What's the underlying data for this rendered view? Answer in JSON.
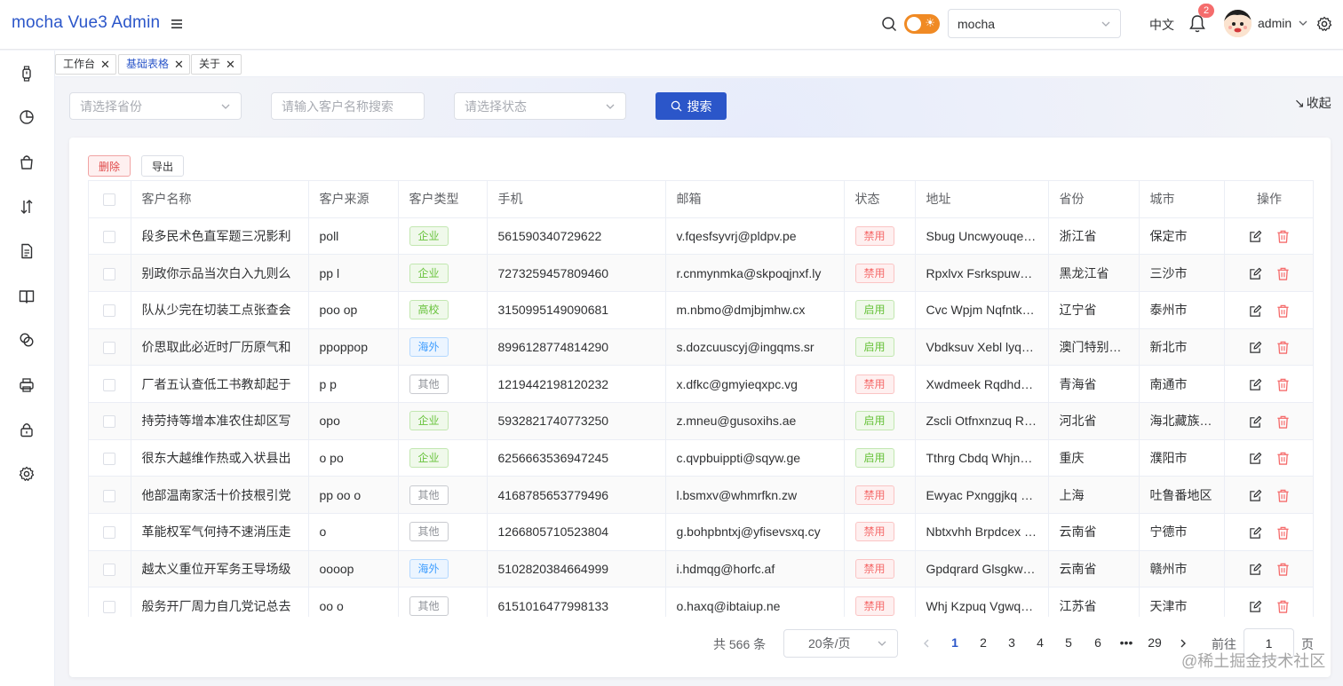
{
  "header": {
    "logo": "mocha Vue3 Admin",
    "select_value": "mocha",
    "lang": "中文",
    "notification_count": "2",
    "username": "admin"
  },
  "sidebar": {
    "icons": [
      "watch-icon",
      "pie-chart-icon",
      "shopping-bag-icon",
      "sort-icon",
      "document-icon",
      "book-icon",
      "link-icon",
      "printer-icon",
      "lock-icon",
      "settings-icon"
    ]
  },
  "tags": [
    {
      "label": "工作台",
      "active": false
    },
    {
      "label": "基础表格",
      "active": true
    },
    {
      "label": "关于",
      "active": false
    }
  ],
  "filters": {
    "province_placeholder": "请选择省份",
    "name_placeholder": "请输入客户名称搜索",
    "status_placeholder": "请选择状态",
    "search_label": "搜索",
    "collapse_label": "收起"
  },
  "toolbar": {
    "delete_label": "删除",
    "export_label": "导出"
  },
  "table": {
    "columns": [
      "客户名称",
      "客户来源",
      "客户类型",
      "手机",
      "邮箱",
      "状态",
      "地址",
      "省份",
      "城市",
      "操作"
    ],
    "rows": [
      {
        "name": "段多民术色直军题三况影利",
        "source": "poll",
        "type": "企业",
        "phone": "561590340729622",
        "email": "v.fqesfsyvrj@pldpv.pe",
        "status": "禁用",
        "address": "Sbug Uncwyouqe Street",
        "province": "浙江省",
        "city": "保定市"
      },
      {
        "name": "别政你示品当次白入九则么",
        "source": "pp l",
        "type": "企业",
        "phone": "7273259457809460",
        "email": "r.cnmynmka@skpoqjnxf.ly",
        "status": "禁用",
        "address": "Rpxlvx Fsrkspuwe Road",
        "province": "黑龙江省",
        "city": "三沙市"
      },
      {
        "name": "队从少完在切装工点张查会",
        "source": "poo op",
        "type": "高校",
        "phone": "3150995149090681",
        "email": "m.nbmo@dmjbjmhw.cx",
        "status": "启用",
        "address": "Cvc Wpjm Nqfntk Lane",
        "province": "辽宁省",
        "city": "泰州市"
      },
      {
        "name": "价思取此必近时厂历原气和",
        "source": "ppoppop",
        "type": "海外",
        "phone": "8996128774814290",
        "email": "s.dozcuuscyj@ingqms.sr",
        "status": "启用",
        "address": "Vbdksuv Xebl lyqw Road",
        "province": "澳门特别行政区",
        "city": "新北市"
      },
      {
        "name": "厂者五认查低工书教却起于",
        "source": "p p",
        "type": "其他",
        "phone": "1219442198120232",
        "email": "x.dfkc@gmyieqxpc.vg",
        "status": "禁用",
        "address": "Xwdmeek Rqdhdw Street",
        "province": "青海省",
        "city": "南通市"
      },
      {
        "name": "持劳持等增本准农住却区写",
        "source": "opo",
        "type": "企业",
        "phone": "5932821740773250",
        "email": "z.mneu@gusoxihs.ae",
        "status": "启用",
        "address": "Zscli Otfnxnzuq Road",
        "province": "河北省",
        "city": "海北藏族自治州"
      },
      {
        "name": "很东大越维作热或入状县出",
        "source": "o po",
        "type": "企业",
        "phone": "6256663536947245",
        "email": "c.qvpbuippti@sqyw.ge",
        "status": "启用",
        "address": "Tthrg Cbdq Whjnk Lane",
        "province": "重庆",
        "city": "濮阳市"
      },
      {
        "name": "他部温南家活十价技根引党",
        "source": "pp oo o",
        "type": "其他",
        "phone": "4168785653779496",
        "email": "l.bsmxv@whmrfkn.zw",
        "status": "禁用",
        "address": "Ewyac Pxnggjkq Street",
        "province": "上海",
        "city": "吐鲁番地区"
      },
      {
        "name": "革能权军气何持不速消压走",
        "source": "o",
        "type": "其他",
        "phone": "1266805710523804",
        "email": "g.bohpbntxj@yfisevsxq.cy",
        "status": "禁用",
        "address": "Nbtxvhh Brpdcex Lane",
        "province": "云南省",
        "city": "宁德市"
      },
      {
        "name": "越太义重位开军务王导场级",
        "source": "oooop",
        "type": "海外",
        "phone": "5102820384664999",
        "email": "i.hdmqg@horfc.af",
        "status": "禁用",
        "address": "Gpdqrard Glsgkw Road",
        "province": "云南省",
        "city": "赣州市"
      },
      {
        "name": "般务开厂周力自几党记总去",
        "source": "oo o",
        "type": "其他",
        "phone": "6151016477998133",
        "email": "o.haxq@ibtaiup.ne",
        "status": "禁用",
        "address": "Whj Kzpuq Vgwqe Street",
        "province": "江苏省",
        "city": "天津市"
      }
    ]
  },
  "pagination": {
    "total": "共 566 条",
    "page_size": "20条/页",
    "pages": [
      "1",
      "2",
      "3",
      "4",
      "5",
      "6",
      "•••",
      "29"
    ],
    "current": "1",
    "goto_label": "前往",
    "goto_value": "1",
    "unit": "页"
  },
  "watermark": "@稀土掘金技术社区",
  "colors": {
    "primary": "#2b56c9",
    "danger": "#f56c6c",
    "success": "#67c23a",
    "info": "#409eff",
    "toggle": "#f08a24"
  }
}
